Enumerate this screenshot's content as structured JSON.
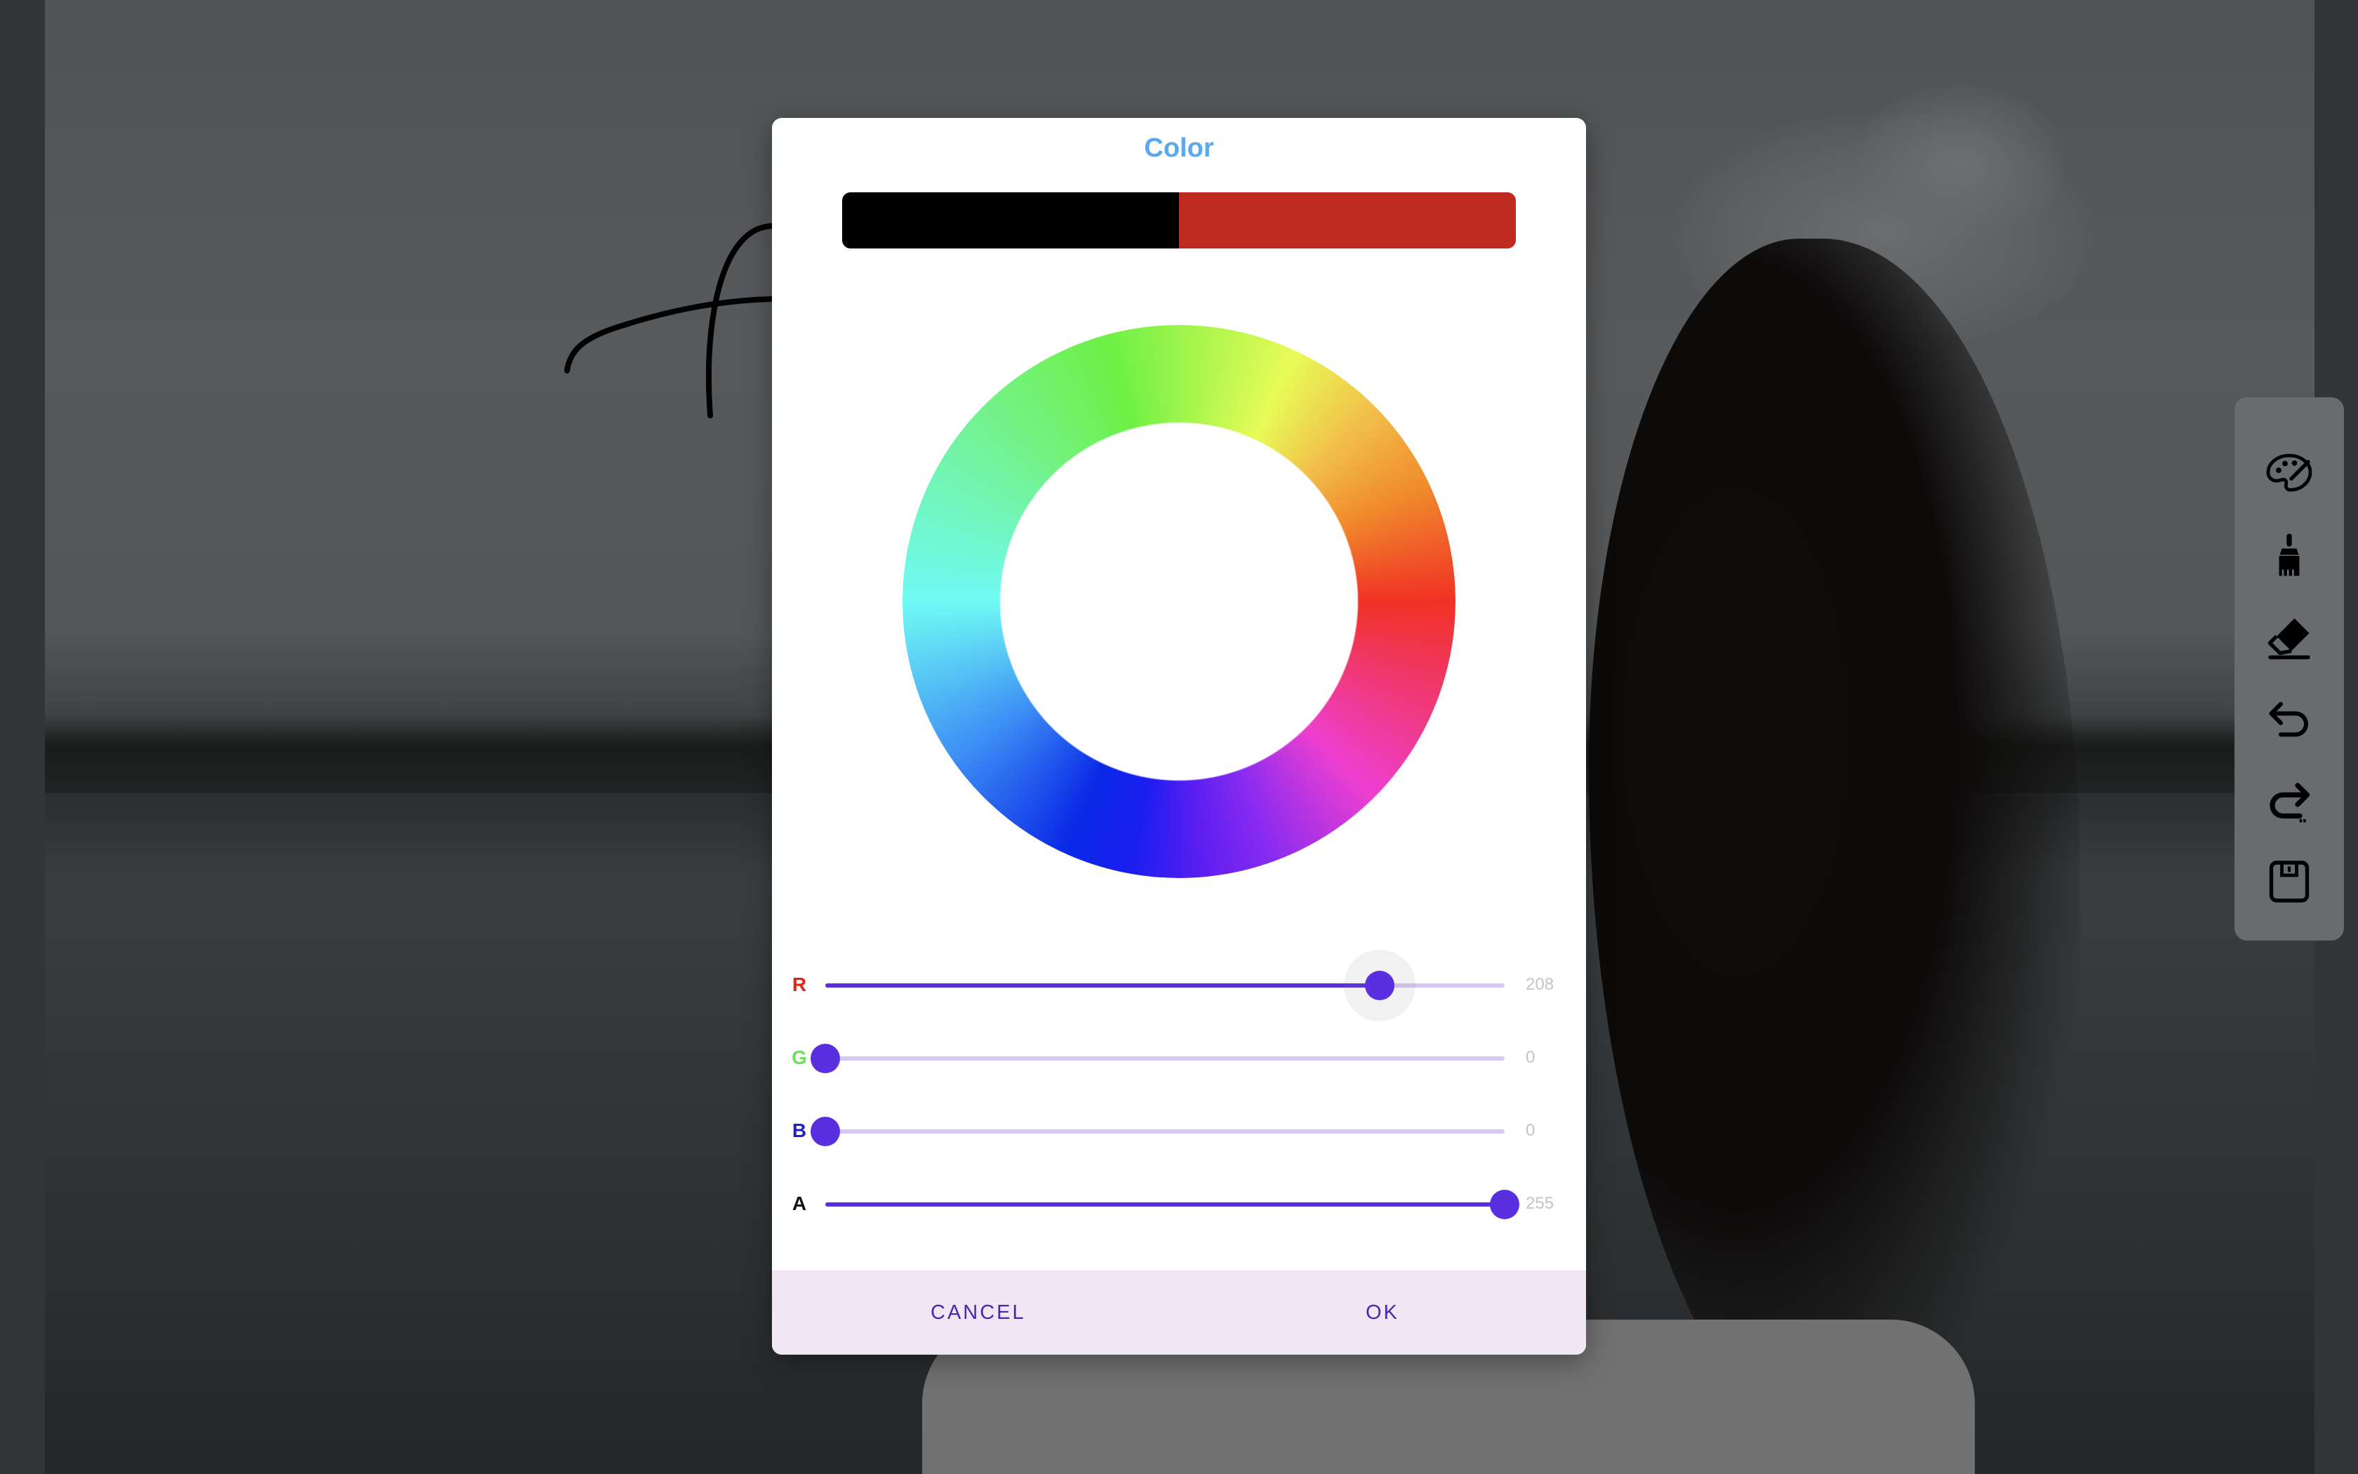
{
  "dialog": {
    "title": "Color",
    "title_color": "#5aa9ef",
    "swatch": {
      "previous_color": "#000000",
      "current_color": "#c0291f"
    },
    "sliders": [
      {
        "label": "R",
        "value": "208",
        "fraction": 0.8157,
        "label_color": "#e0241a"
      },
      {
        "label": "G",
        "value": "0",
        "fraction": 0.0,
        "label_color": "#6ee05a"
      },
      {
        "label": "B",
        "value": "0",
        "fraction": 0.0,
        "label_color": "#2020c8"
      },
      {
        "label": "A",
        "value": "255",
        "fraction": 1.0,
        "label_color": "#111111"
      }
    ],
    "accent_color": "#5a2fe0",
    "footer": {
      "cancel_label": "CANCEL",
      "ok_label": "OK"
    }
  },
  "toolbar": {
    "tools": [
      {
        "name": "palette-icon"
      },
      {
        "name": "brush-icon"
      },
      {
        "name": "eraser-icon"
      },
      {
        "name": "undo-icon"
      },
      {
        "name": "redo-icon"
      },
      {
        "name": "save-icon"
      }
    ]
  }
}
